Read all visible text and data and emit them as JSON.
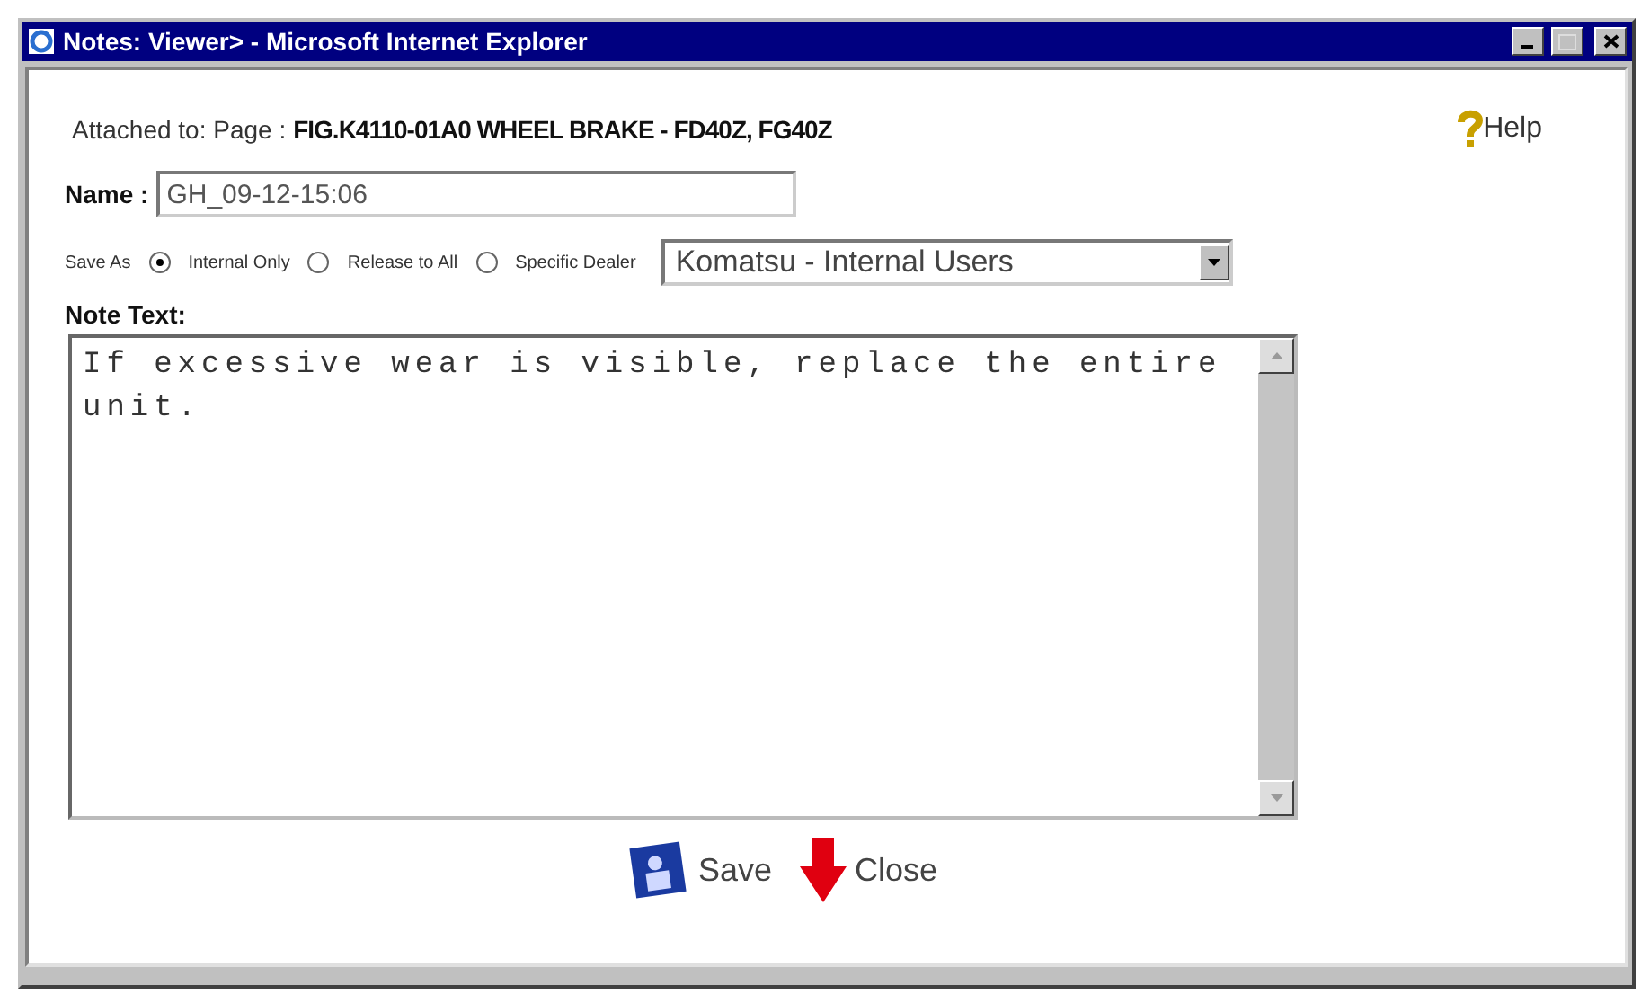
{
  "window": {
    "title": "Notes: Viewer> - Microsoft Internet Explorer"
  },
  "attached": {
    "label": "Attached to: Page :",
    "value": "FIG.K4110-01A0 WHEEL BRAKE - FD40Z, FG40Z"
  },
  "help": {
    "label": "Help"
  },
  "name_field": {
    "label": "Name :",
    "value": "GH_09-12-15:06"
  },
  "save_as": {
    "label": "Save As",
    "options": [
      {
        "label": "Internal Only",
        "selected": true
      },
      {
        "label": "Release to All",
        "selected": false
      },
      {
        "label": "Specific Dealer",
        "selected": false
      }
    ]
  },
  "dealer_select": {
    "value": "Komatsu - Internal Users"
  },
  "note": {
    "label": "Note Text:",
    "value": "If excessive wear is visible, replace the entire unit."
  },
  "buttons": [
    {
      "kind": "save",
      "label": "Save"
    },
    {
      "kind": "close",
      "label": "Close"
    }
  ]
}
